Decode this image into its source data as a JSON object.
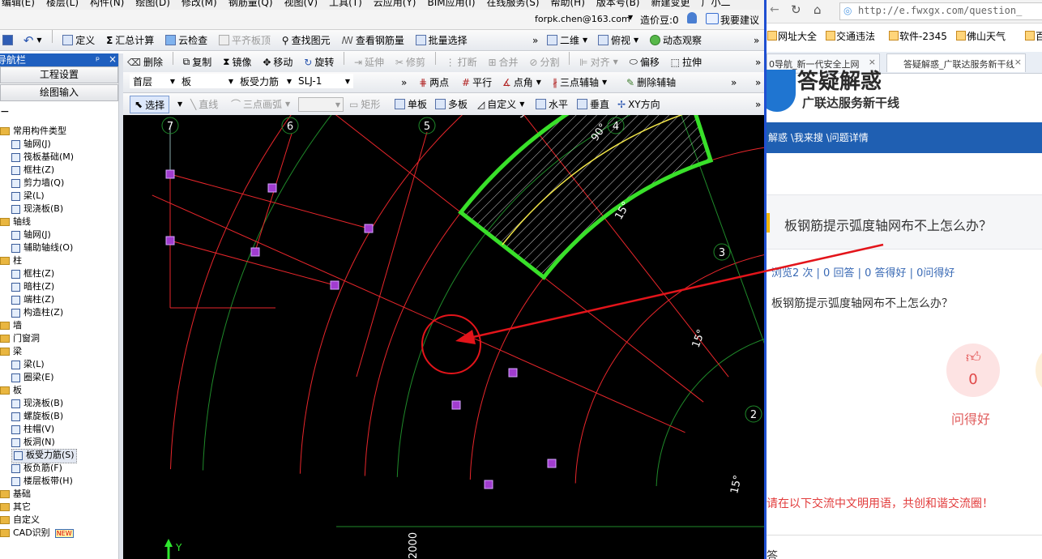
{
  "menubar": {
    "items": [
      "编辑(E)",
      "楼层(L)",
      "构件(N)",
      "绘图(D)",
      "修改(M)",
      "钢筋量(Q)",
      "视图(V)",
      "工具(T)",
      "云应用(Y)",
      "BIM应用(I)",
      "在线服务(S)",
      "帮助(H)",
      "版本号(B)",
      "新建变更",
      "广小二"
    ]
  },
  "account": {
    "email": "forpk.chen@163.com",
    "beans": "造价豆:0",
    "suggest": "我要建议"
  },
  "toolbar1": {
    "define": "定义",
    "sum": "汇总计算",
    "cloud_check": "云检查",
    "flat_top": "平齐板顶",
    "find": "查找图元",
    "view_rebar": "查看钢筋量",
    "batch_select": "批量选择",
    "view_2d": "二维",
    "top_view": "俯视",
    "dynamic": "动态观察"
  },
  "toolbar2": {
    "delete": "删除",
    "copy": "复制",
    "mirror": "镜像",
    "move": "移动",
    "rotate": "旋转",
    "extend": "延伸",
    "trim": "修剪",
    "break": "打断",
    "merge": "合并",
    "split": "分割",
    "align": "对齐",
    "offset": "偏移",
    "stretch": "拉伸"
  },
  "toolbar3": {
    "floor": "首层",
    "category": "板",
    "type": "板受力筋",
    "name": "SLJ-1",
    "two_point": "两点",
    "parallel": "平行",
    "point_angle": "点角",
    "three_point_aux": "三点辅轴",
    "delete_aux": "删除辅轴"
  },
  "toolbar4": {
    "select": "选择",
    "line": "直线",
    "arc3": "三点画弧",
    "rect": "矩形",
    "single": "单板",
    "multi": "多板",
    "custom": "自定义",
    "horizontal": "水平",
    "vertical": "垂直",
    "xy": "XY方向"
  },
  "nav": {
    "title": "导航栏",
    "project_settings": "工程设置",
    "draw_input": "绘图输入",
    "tree": [
      {
        "label": "常用构件类型",
        "kind": "folder",
        "depth": 0
      },
      {
        "label": "轴网(J)",
        "kind": "item",
        "depth": 1
      },
      {
        "label": "筏板基础(M)",
        "kind": "item",
        "depth": 1
      },
      {
        "label": "框柱(Z)",
        "kind": "item",
        "depth": 1
      },
      {
        "label": "剪力墙(Q)",
        "kind": "item",
        "depth": 1
      },
      {
        "label": "梁(L)",
        "kind": "item",
        "depth": 1
      },
      {
        "label": "现浇板(B)",
        "kind": "item",
        "depth": 1
      },
      {
        "label": "轴线",
        "kind": "folder",
        "depth": 0
      },
      {
        "label": "轴网(J)",
        "kind": "item",
        "depth": 1
      },
      {
        "label": "辅助轴线(O)",
        "kind": "item",
        "depth": 1
      },
      {
        "label": "柱",
        "kind": "folder",
        "depth": 0
      },
      {
        "label": "框柱(Z)",
        "kind": "item",
        "depth": 1
      },
      {
        "label": "暗柱(Z)",
        "kind": "item",
        "depth": 1
      },
      {
        "label": "端柱(Z)",
        "kind": "item",
        "depth": 1
      },
      {
        "label": "构造柱(Z)",
        "kind": "item",
        "depth": 1
      },
      {
        "label": "墙",
        "kind": "folder",
        "depth": 0
      },
      {
        "label": "门窗洞",
        "kind": "folder",
        "depth": 0
      },
      {
        "label": "梁",
        "kind": "folder",
        "depth": 0
      },
      {
        "label": "梁(L)",
        "kind": "item",
        "depth": 1
      },
      {
        "label": "圈梁(E)",
        "kind": "item",
        "depth": 1
      },
      {
        "label": "板",
        "kind": "folder",
        "depth": 0
      },
      {
        "label": "现浇板(B)",
        "kind": "item",
        "depth": 1
      },
      {
        "label": "螺旋板(B)",
        "kind": "item",
        "depth": 1
      },
      {
        "label": "柱帽(V)",
        "kind": "item",
        "depth": 1
      },
      {
        "label": "板洞(N)",
        "kind": "item",
        "depth": 1
      },
      {
        "label": "板受力筋(S)",
        "kind": "item",
        "depth": 1,
        "selected": true
      },
      {
        "label": "板负筋(F)",
        "kind": "item",
        "depth": 1
      },
      {
        "label": "楼层板带(H)",
        "kind": "item",
        "depth": 1
      },
      {
        "label": "基础",
        "kind": "folder",
        "depth": 0
      },
      {
        "label": "其它",
        "kind": "folder",
        "depth": 0
      },
      {
        "label": "自定义",
        "kind": "folder",
        "depth": 0
      },
      {
        "label": "CAD识别",
        "kind": "folder",
        "depth": 0
      }
    ],
    "new_badge": "NEW"
  },
  "cad": {
    "axis_labels": [
      "7",
      "6",
      "5",
      "4",
      "3",
      "2"
    ],
    "angles": [
      "5°",
      "90°",
      "15°",
      "15°",
      "15°"
    ],
    "dim_text": "2000",
    "y_label": "Y"
  },
  "browser": {
    "url": "http://e.fwxgx.com/question_",
    "bookmarks": [
      "网址大全",
      "交通违法",
      "软件-2345",
      "佛山天气",
      "百"
    ],
    "tabs": [
      "0导航_新一代安全上网",
      "答疑解惑_广联达服务新干线"
    ],
    "logo_title": "答疑解惑",
    "logo_sub": "广联达服务新干线",
    "breadcrumb": "解惑 \\我来搜 \\问题详情",
    "question_title": "板钢筋提示弧度轴网布不上怎么办？",
    "stats": "浏览2 次 | 0 回答 | 0 答得好 | 0问得好",
    "question_body": "板钢筋提示弧度轴网布不上怎么办？",
    "like_count": "0",
    "like_label": "问得好",
    "notice": "请在以下交流中文明用语，共创和谐交流圈！",
    "answer_head": "答"
  },
  "colors": {
    "accent": "#1f5fbf",
    "slab_edge": "#39e02a",
    "arrow": "#e3141a",
    "browser_bar": "#1f5fb2",
    "notice": "#e23c3c"
  }
}
